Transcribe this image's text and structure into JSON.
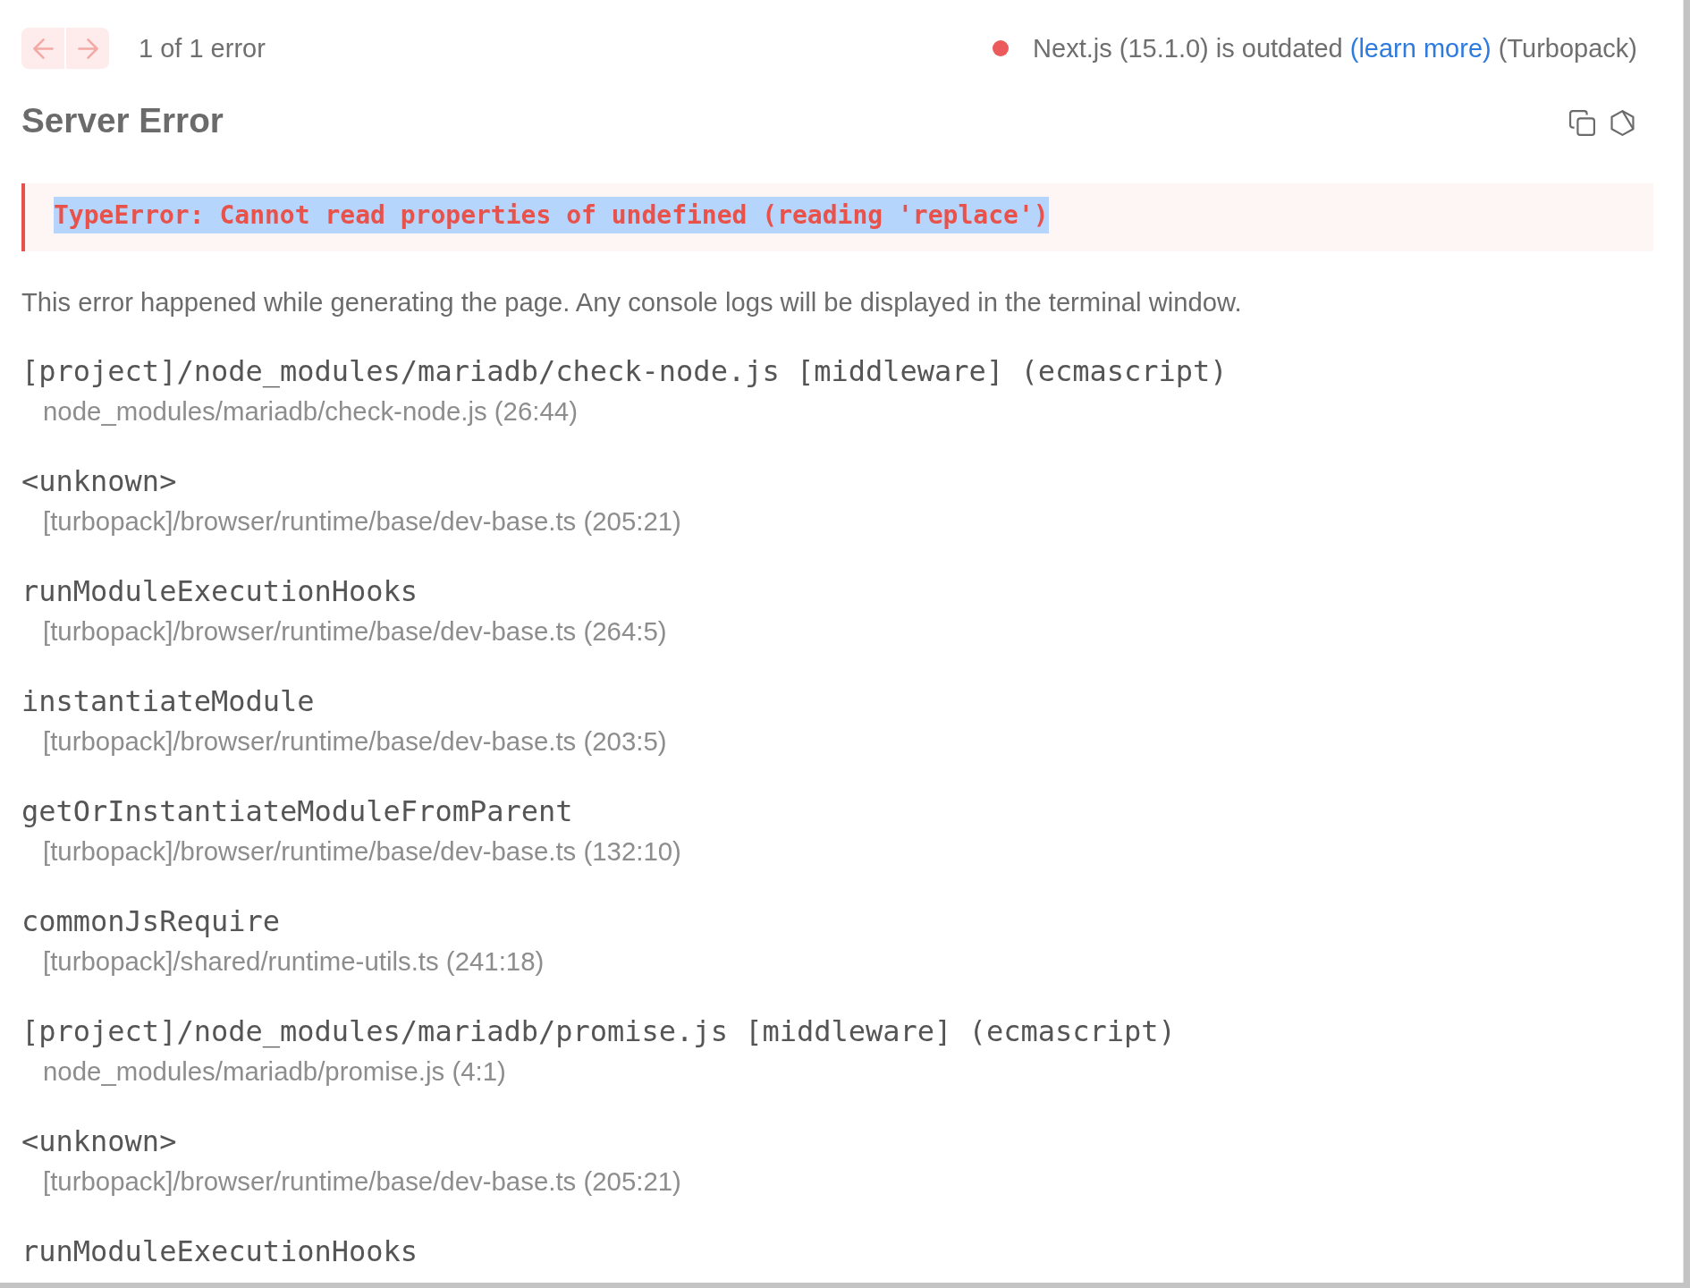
{
  "toolbar": {
    "nav_buttons": [
      {
        "kind": "previous",
        "disabled": true
      },
      {
        "kind": "next",
        "disabled": true
      }
    ],
    "counter": "1 of 1 error",
    "version": {
      "color": "#ec5b5b",
      "text": "Next.js (15.1.0) is outdated",
      "link": "(learn more)",
      "suffix": "(Turbopack)"
    }
  },
  "header": {
    "title": "Server Error",
    "actions": [
      {
        "kind": "copy"
      },
      {
        "kind": "hexagon"
      }
    ]
  },
  "error": {
    "message": "TypeError: Cannot read properties of undefined (reading 'replace')",
    "highlighted": true
  },
  "description": "This error happened while generating the page. Any console logs will be displayed in the terminal window.",
  "frames": [
    {
      "function": "[project]/node_modules/mariadb/check-node.js [middleware] (ecmascript)",
      "location": "node_modules/mariadb/check-node.js (26:44)"
    },
    {
      "function": "<unknown>",
      "location": "[turbopack]/browser/runtime/base/dev-base.ts (205:21)"
    },
    {
      "function": "runModuleExecutionHooks",
      "location": "[turbopack]/browser/runtime/base/dev-base.ts (264:5)"
    },
    {
      "function": "instantiateModule",
      "location": "[turbopack]/browser/runtime/base/dev-base.ts (203:5)"
    },
    {
      "function": "getOrInstantiateModuleFromParent",
      "location": "[turbopack]/browser/runtime/base/dev-base.ts (132:10)"
    },
    {
      "function": "commonJsRequire",
      "location": "[turbopack]/shared/runtime-utils.ts (241:18)"
    },
    {
      "function": "[project]/node_modules/mariadb/promise.js [middleware] (ecmascript)",
      "location": "node_modules/mariadb/promise.js (4:1)"
    },
    {
      "function": "<unknown>",
      "location": "[turbopack]/browser/runtime/base/dev-base.ts (205:21)"
    },
    {
      "function": "runModuleExecutionHooks"
    }
  ]
}
